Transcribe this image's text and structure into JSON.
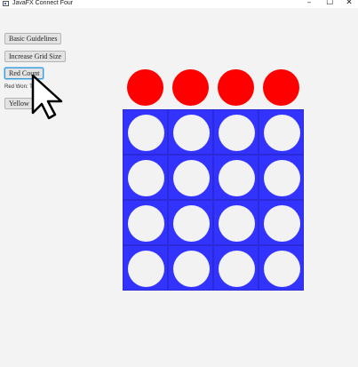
{
  "window": {
    "title": "JavaFX Connect Four",
    "minimize": "–",
    "maximize": "☐",
    "close": "✕"
  },
  "controls": {
    "basic_guidelines": "Basic Guidelines",
    "increase_grid": "Increase Grid Size",
    "red_count": "Red Count",
    "status": "Red Won: Times",
    "yellow_count": "Yellow"
  },
  "board": {
    "columns": 4,
    "rows": 4,
    "top_disc_color": "#ff0000",
    "board_color": "#3333ff",
    "hole_color": "#f2f2f2"
  }
}
